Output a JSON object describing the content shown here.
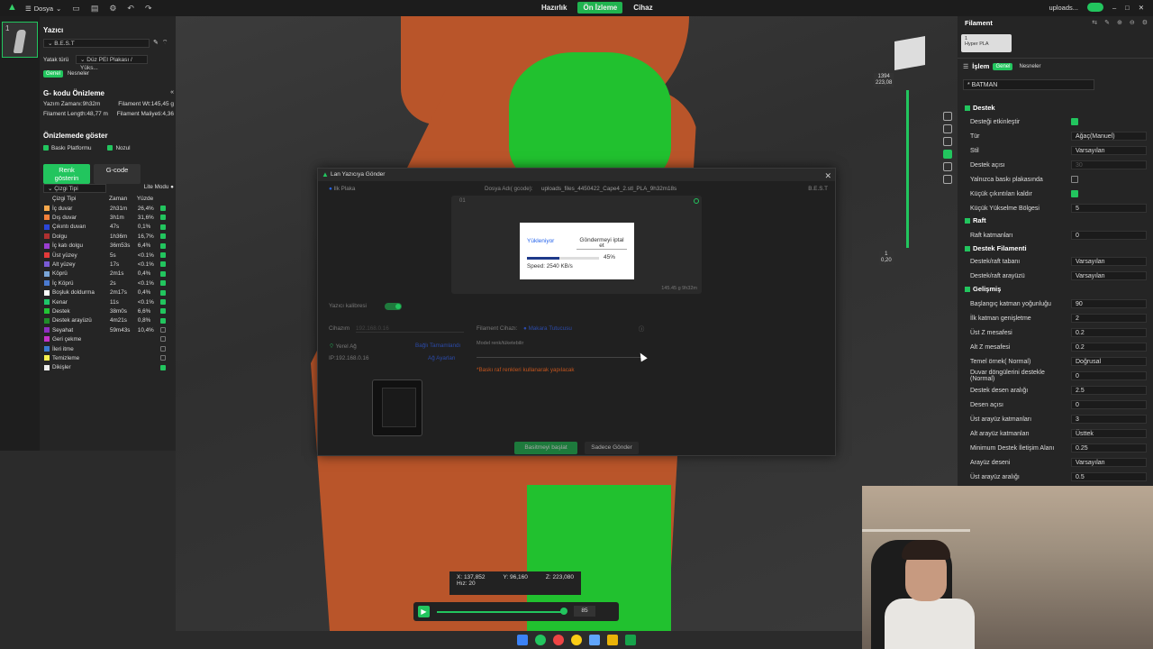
{
  "app": {
    "menu_label": "Dosya",
    "tabs": [
      "Hazırlık",
      "Ön İzleme",
      "Cihaz"
    ],
    "active_tab": "Ön İzleme",
    "right_text": "uploads..."
  },
  "left": {
    "plate_number": "1",
    "printer_title": "Yazıcı",
    "printer_name": "B.E.S.T",
    "bed_type_label": "Yatak türü",
    "bed_type_value": "Düz PEI Plakası / Yüks...",
    "global_chip": "Genel",
    "objects_chip": "Nesneler",
    "gcode_title": "G- kodu Önizleme",
    "print_time": "Yazım Zamanı:9h32m",
    "filament_wt": "Filament Wt:145,45 g",
    "filament_length": "Filament Length:48,77 m",
    "filament_cost": "Filament Maliyeti:4,36",
    "show_title": "Önizlemede göster",
    "show_bed": "Baskı Platformu",
    "show_nozzle": "Nozul",
    "btn_color": "Renk gösterin",
    "btn_gcode": "G-code",
    "line_type_select": "Çizgi Tipi",
    "lite_mode": "Lite Modu",
    "table_headers": [
      "Çizgi Tipi",
      "Zaman",
      "Yüzde"
    ],
    "rows": [
      {
        "name": "İç duvar",
        "time": "2h31m",
        "pct": "26,4%",
        "color": "#f7a84c",
        "on": true
      },
      {
        "name": "Dış duvar",
        "time": "3h1m",
        "pct": "31,6%",
        "color": "#f4803a",
        "on": true
      },
      {
        "name": "Çıkıntı duvarı",
        "time": "47s",
        "pct": "0,1%",
        "color": "#2b46d8",
        "on": true
      },
      {
        "name": "Dolgu",
        "time": "1h36m",
        "pct": "16,7%",
        "color": "#b03030",
        "on": true
      },
      {
        "name": "İç katı dolgu",
        "time": "36m53s",
        "pct": "6,4%",
        "color": "#9a3ed0",
        "on": true
      },
      {
        "name": "Üst yüzey",
        "time": "5s",
        "pct": "<0.1%",
        "color": "#e33a3a",
        "on": true
      },
      {
        "name": "Alt yüzey",
        "time": "17s",
        "pct": "<0.1%",
        "color": "#7a5bd6",
        "on": true
      },
      {
        "name": "Köprü",
        "time": "2m1s",
        "pct": "0,4%",
        "color": "#7aa6d8",
        "on": true
      },
      {
        "name": "İç Köprü",
        "time": "2s",
        "pct": "<0.1%",
        "color": "#4b7bd1",
        "on": true
      },
      {
        "name": "Boşluk doldurma",
        "time": "2m17s",
        "pct": "0,4%",
        "color": "#ffffff",
        "on": true
      },
      {
        "name": "Kenar",
        "time": "11s",
        "pct": "<0.1%",
        "color": "#1ec76a",
        "on": true
      },
      {
        "name": "Destek",
        "time": "38m0s",
        "pct": "6,6%",
        "color": "#22c535",
        "on": true
      },
      {
        "name": "Destek arayüzü",
        "time": "4m21s",
        "pct": "0,8%",
        "color": "#1f8e2a",
        "on": true
      },
      {
        "name": "Seyahat",
        "time": "59m43s",
        "pct": "10,4%",
        "color": "#8e2ec0",
        "on": false
      },
      {
        "name": "Geri çekme",
        "time": "",
        "pct": "",
        "color": "#c433c9",
        "on": false
      },
      {
        "name": "İleri itme",
        "time": "",
        "pct": "",
        "color": "#3a7bd1",
        "on": false
      },
      {
        "name": "Temizleme",
        "time": "",
        "pct": "",
        "color": "#f7f050",
        "on": false
      },
      {
        "name": "Dikişler",
        "time": "",
        "pct": "",
        "color": "#eeeeee",
        "on": true
      }
    ]
  },
  "viewport": {
    "label_01": "01",
    "top_value_a": "1394",
    "top_value_b": "223,08",
    "bottom_value_a": "1",
    "bottom_value_b": "0,20",
    "coord_x": "X: 137,852",
    "coord_y": "Y: 96,160",
    "coord_z": "Z: 223,080",
    "speed": "Hız: 20",
    "layer_value": "85"
  },
  "dialog": {
    "title": "Lan Yazıcıya Gönder",
    "plate_label": "Ilk Plaka",
    "filename_label": "Dosya Adı( gcode):",
    "filename_value": "uploads_files_4450422_Cape4_2.stl_PLA_9h32m18s",
    "printer_label": "B.E.S.T",
    "preview_num": "01",
    "preview_footer": "145.45 g   9h32m",
    "upload_tab": "Yükleniyor",
    "cancel_tab": "Göndermeyi iptal et",
    "progress_pct": "45%",
    "progress_fraction": 0.45,
    "speed": "Speed: 2540 KB/s",
    "calib_label": "Yazıcı kalibresi",
    "device_label": "Cihazım",
    "device_value": "192.168.0.16",
    "lan_label": "Yerel Ağ",
    "lan_link": "Bağlı Tamamlandı",
    "ip_label": "IP:192.168.0.16",
    "network_link": "Ağ Ayarları",
    "filament_label": "Filament Cihazı:",
    "spool_label": "Makara Tutucusu",
    "model_note": "Model renk/tüketebilir",
    "warn": "*Baskı raf renkleri kullanarak yapılacak",
    "btn_print": "Basitmeyi başlat",
    "btn_send": "Sadece Gönder"
  },
  "right": {
    "filament_title": "Filament",
    "filament_slot": "1",
    "filament_name": "Hyper PLA",
    "process_title": "İşlem",
    "chip_global": "Genel",
    "chip_objects": "Nesneler",
    "preset": "* BATMAN",
    "sec_support": "Destek",
    "sec_raft": "Raft",
    "sec_support_fil": "Destek Filamenti",
    "sec_advanced": "Gelişmiş",
    "rows": [
      {
        "label": "Desteği etkinleştir",
        "value": "",
        "type": "check_on"
      },
      {
        "label": "Tür",
        "value": "Ağaç(Manuel)",
        "type": "select"
      },
      {
        "label": "Stil",
        "value": "Varsayılan",
        "type": "select"
      },
      {
        "label": "Destek açısı",
        "value": "30",
        "type": "input_dim"
      },
      {
        "label": "Yalnızca baskı plakasında",
        "value": "",
        "type": "check_off"
      },
      {
        "label": "Küçük çıkıntıları kaldır",
        "value": "",
        "type": "check_on"
      },
      {
        "label": "Küçük Yükselme Bölgesi",
        "value": "5",
        "type": "input"
      }
    ],
    "raft_rows": [
      {
        "label": "Raft katmanları",
        "value": "0"
      }
    ],
    "fil_rows": [
      {
        "label": "Destek/raft tabanı",
        "value": "Varsayılan"
      },
      {
        "label": "Destek/raft arayüzü",
        "value": "Varsayılan"
      }
    ],
    "adv_rows": [
      {
        "label": "Başlangıç katman yoğunluğu",
        "value": "90"
      },
      {
        "label": "İlk katman genişletme",
        "value": "2"
      },
      {
        "label": "Üst Z mesafesi",
        "value": "0.2"
      },
      {
        "label": "Alt Z mesafesi",
        "value": "0.2"
      },
      {
        "label": "Temel örnek( Normal)",
        "value": "Doğrusal"
      },
      {
        "label": "Duvar döngülerini destekle (Normal)",
        "value": "0"
      },
      {
        "label": "Destek desen aralığı",
        "value": "2.5"
      },
      {
        "label": "Desen açısı",
        "value": "0"
      },
      {
        "label": "Üst arayüz katmanları",
        "value": "3"
      },
      {
        "label": "Alt arayüz katmanları",
        "value": "Üsttek"
      },
      {
        "label": "Minimum Destek İletişim Alanı",
        "value": "0.25"
      },
      {
        "label": "Arayüz deseni",
        "value": "Varsayılan"
      },
      {
        "label": "Üst arayüz aralığı",
        "value": "0.5"
      }
    ]
  },
  "colors": {
    "accent": "#22c55e",
    "model_brown": "#b9552a",
    "support_green": "#21c12f"
  }
}
